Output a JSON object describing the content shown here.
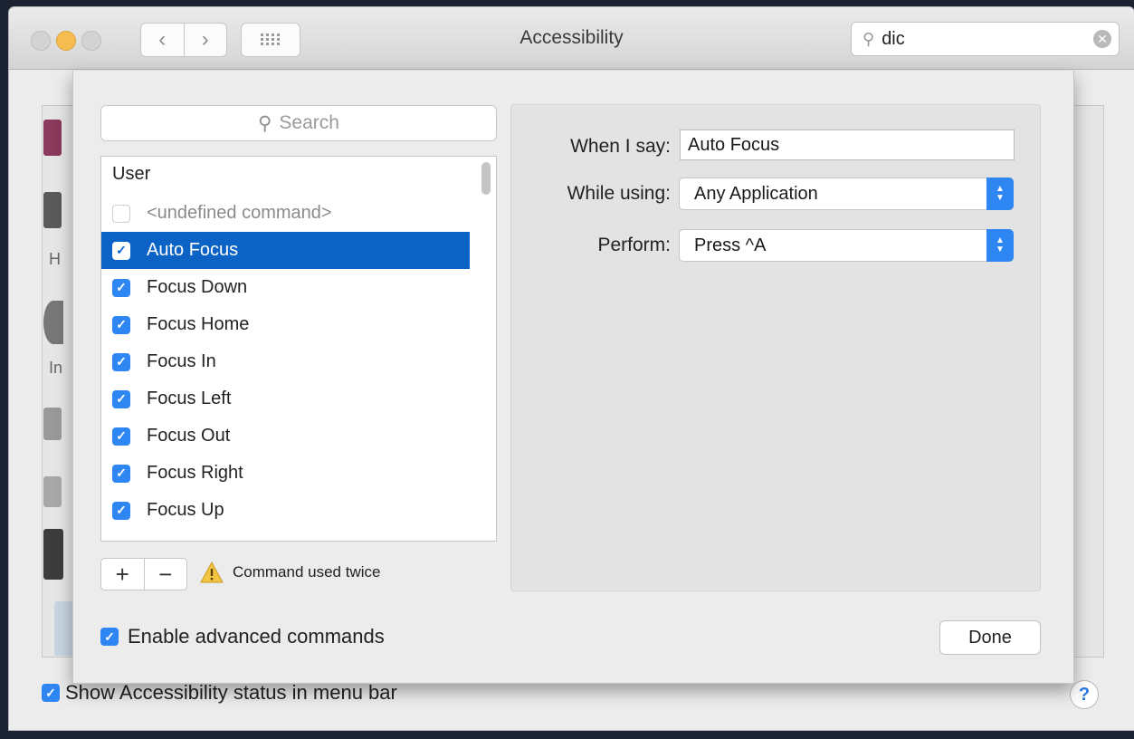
{
  "window": {
    "title": "Accessibility",
    "search_value": "dic"
  },
  "sheet": {
    "list_search_placeholder": "Search",
    "list_header": "User",
    "commands": [
      {
        "label": "<undefined command>",
        "checked": false,
        "state": "disabled"
      },
      {
        "label": "Auto Focus",
        "checked": true,
        "state": "selected"
      },
      {
        "label": "Focus Down",
        "checked": true,
        "state": "normal"
      },
      {
        "label": "Focus Home",
        "checked": true,
        "state": "normal"
      },
      {
        "label": "Focus In",
        "checked": true,
        "state": "normal"
      },
      {
        "label": "Focus Left",
        "checked": true,
        "state": "normal"
      },
      {
        "label": "Focus Out",
        "checked": true,
        "state": "normal"
      },
      {
        "label": "Focus Right",
        "checked": true,
        "state": "normal"
      },
      {
        "label": "Focus Up",
        "checked": true,
        "state": "normal"
      }
    ],
    "add_label": "+",
    "remove_label": "−",
    "warning_text": "Command used twice",
    "form": {
      "when_label": "When I say:",
      "when_value": "Auto Focus",
      "while_label": "While using:",
      "while_value": "Any Application",
      "perform_label": "Perform:",
      "perform_value": "Press ^A"
    },
    "enable_advanced_label": "Enable advanced commands",
    "enable_advanced_checked": true,
    "done_label": "Done"
  },
  "footer": {
    "show_status_label": "Show Accessibility status in menu bar",
    "show_status_checked": true,
    "help_label": "?"
  },
  "background_fragments": [
    "H",
    "In"
  ],
  "colors": {
    "accent": "#2e86f3",
    "selection": "#0b63c5",
    "window_bg": "#ececec"
  }
}
